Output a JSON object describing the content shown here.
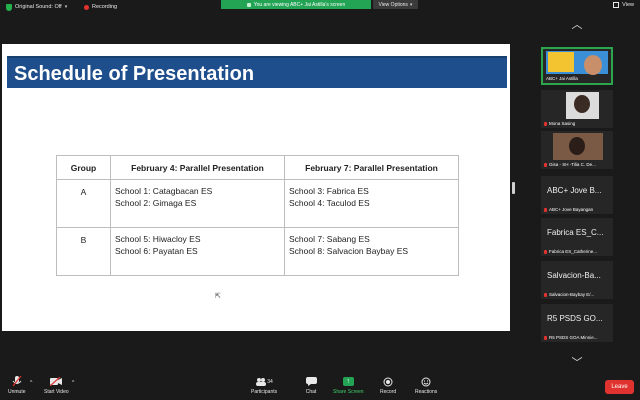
{
  "topbar": {
    "original_sound": "Original Sound: Off",
    "recording": "Recording",
    "viewing_banner": "You are viewing ABC+ Jai Astilla's screen",
    "view_options": "View Options",
    "view": "View"
  },
  "slide": {
    "title": "Schedule of Presentation",
    "table": {
      "headers": [
        "Group",
        "February 4: Parallel Presentation",
        "February 7: Parallel Presentation"
      ],
      "rows": [
        {
          "group": "A",
          "feb4": [
            "School 1: Catagbacan ES",
            "School 2: Gimaga ES"
          ],
          "feb7": [
            "School 3: Fabrica ES",
            "School 4: Taculod ES"
          ]
        },
        {
          "group": "B",
          "feb4": [
            "School 5: Hiwacloy ES",
            "School 6: Payatan ES"
          ],
          "feb7": [
            "School 7: Sabang ES",
            "School 8: Salvacion Baybay ES"
          ]
        }
      ]
    }
  },
  "participants": [
    {
      "name": "ABC+ Jai Astilla",
      "type": "video-cartoon",
      "active": true
    },
    {
      "name": "Mona Sasing",
      "type": "video"
    },
    {
      "name": "Gisa - SH -Tilia C. De...",
      "type": "video"
    },
    {
      "name": "ABC+ Jove Bayangan",
      "big": "ABC+ Jove B..."
    },
    {
      "name": "Fabrica ES_Catherine...",
      "big": "Fabrica ES_C..."
    },
    {
      "name": "Salvacion-Baybay E/...",
      "big": "Salvacion-Ba..."
    },
    {
      "name": "R5 PSDS GOA Minnie...",
      "big": "R5 PSDS GO..."
    }
  ],
  "toolbar": {
    "unmute": "Unmute",
    "start_video": "Start Video",
    "participants": "Participants",
    "participants_count": "34",
    "chat": "Chat",
    "share_screen": "Share Screen",
    "record": "Record",
    "reactions": "Reactions",
    "leave": "Leave"
  },
  "colors": {
    "title_bar": "#1f4e8c",
    "share_green": "#23a455",
    "leave_red": "#e0322e",
    "active_border": "#2da44e"
  }
}
